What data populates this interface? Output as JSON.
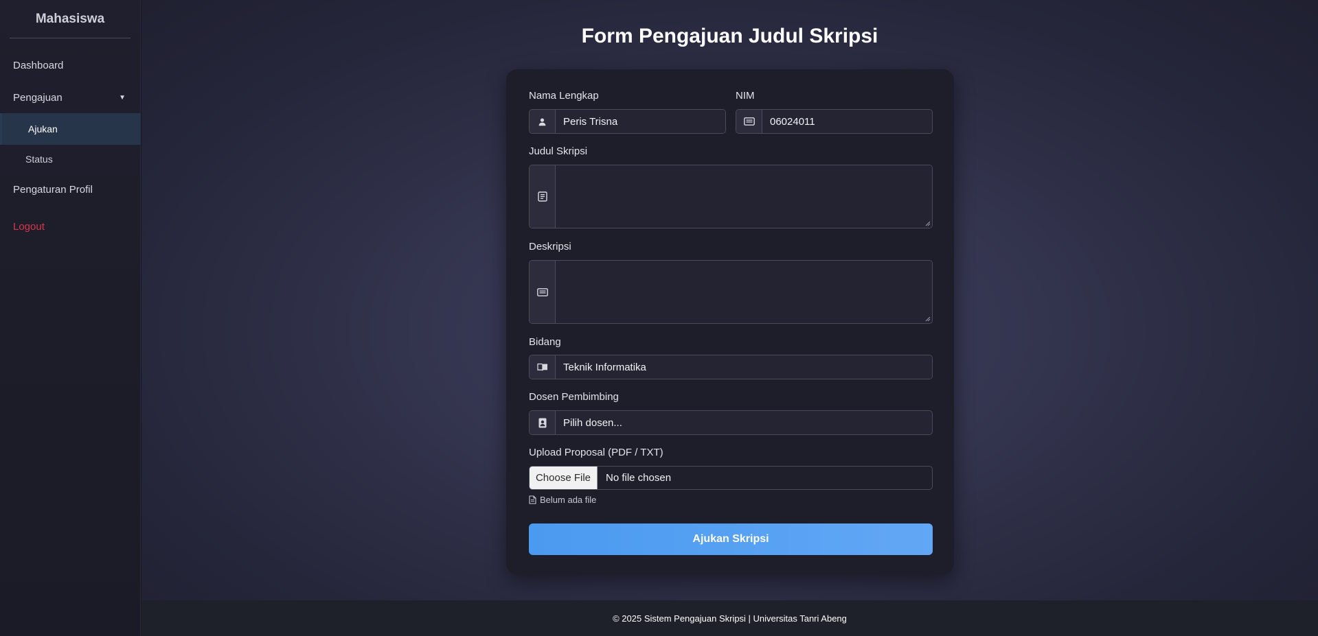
{
  "sidebar": {
    "brand": "Mahasiswa",
    "items": {
      "dashboard": "Dashboard",
      "pengajuan": "Pengajuan",
      "ajukan": "Ajukan",
      "status": "Status",
      "profil": "Pengaturan Profil",
      "logout": "Logout"
    },
    "logout_color": "#d9364c"
  },
  "main": {
    "title": "Form Pengajuan Judul Skripsi"
  },
  "form": {
    "nama_label": "Nama Lengkap",
    "nama_value": "Peris Trisna",
    "nim_label": "NIM",
    "nim_value": "06024011",
    "judul_label": "Judul Skripsi",
    "judul_value": "",
    "deskripsi_label": "Deskripsi",
    "deskripsi_value": "",
    "bidang_label": "Bidang",
    "bidang_value": "Teknik Informatika",
    "dosen_label": "Dosen Pembimbing",
    "dosen_value": "Pilih dosen...",
    "upload_label": "Upload Proposal (PDF / TXT)",
    "file_button": "Choose File",
    "file_status": "No file chosen",
    "file_note": "Belum ada file",
    "submit_label": "Ajukan Skripsi",
    "accent": "#4a9af0"
  },
  "footer": {
    "text": "© 2025 Sistem Pengajuan Skripsi | Universitas Tanri Abeng"
  }
}
